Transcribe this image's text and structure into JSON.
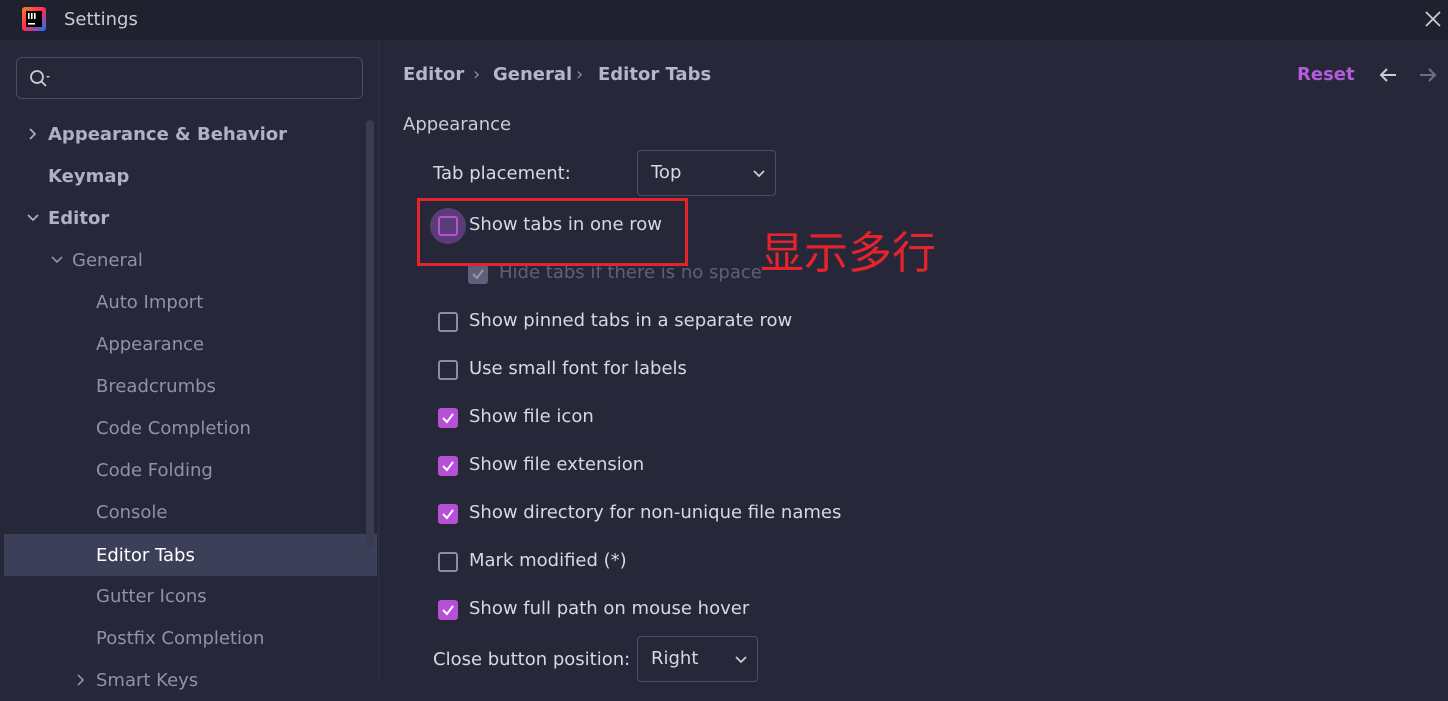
{
  "window": {
    "title": "Settings"
  },
  "sidebar": {
    "search_placeholder": "",
    "items": [
      {
        "label": "Appearance & Behavior"
      },
      {
        "label": "Keymap"
      },
      {
        "label": "Editor"
      },
      {
        "label": "General"
      },
      {
        "label": "Auto Import"
      },
      {
        "label": "Appearance"
      },
      {
        "label": "Breadcrumbs"
      },
      {
        "label": "Code Completion"
      },
      {
        "label": "Code Folding"
      },
      {
        "label": "Console"
      },
      {
        "label": "Editor Tabs"
      },
      {
        "label": "Gutter Icons"
      },
      {
        "label": "Postfix Completion"
      },
      {
        "label": "Smart Keys"
      }
    ]
  },
  "header": {
    "breadcrumb": [
      "Editor",
      "General",
      "Editor Tabs"
    ],
    "separator": "›",
    "reset_label": "Reset"
  },
  "main": {
    "section_title": "Appearance",
    "tab_placement": {
      "label": "Tab placement:",
      "value": "Top"
    },
    "options": [
      {
        "label": "Show tabs in one row",
        "checked": false
      },
      {
        "label": "Hide tabs if there is no space",
        "checked": true,
        "disabled": true
      },
      {
        "label": "Show pinned tabs in a separate row",
        "checked": false
      },
      {
        "label": "Use small font for labels",
        "checked": false
      },
      {
        "label": "Show file icon",
        "checked": true
      },
      {
        "label": "Show file extension",
        "checked": true
      },
      {
        "label": "Show directory for non-unique file names",
        "checked": true
      },
      {
        "label": "Mark modified (*)",
        "checked": false
      },
      {
        "label": "Show full path on mouse hover",
        "checked": true
      }
    ],
    "close_button_position": {
      "label": "Close button position:",
      "value": "Right"
    }
  },
  "annotation": {
    "text": "显示多行",
    "color": "#e5232b"
  },
  "colors": {
    "accent": "#b650d4",
    "reset": "#b45cdc",
    "background": "#262839"
  }
}
